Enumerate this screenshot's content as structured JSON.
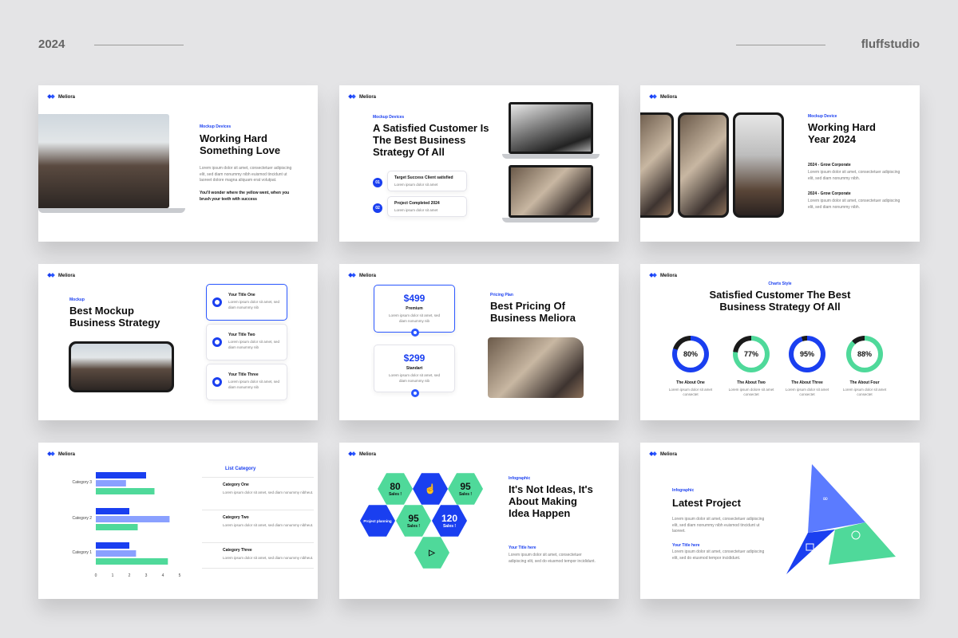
{
  "header": {
    "year": "2024",
    "studio": "fluffstudio"
  },
  "brand": "Meliora",
  "lorem_short": "Lorem ipsum dolor sit amet, consectetur adipiscing elit, sed diam nonummy nibh euismod tincidunt ut laoreet dolore magna aliquam erat.",
  "slides": {
    "s1": {
      "tag": "Mockup Devices",
      "title": "Working Hard Something Love",
      "body": "Lorem ipsum dolor sit amet, consectetuer adipiscing elit, sed diam nonummy nibh euismod tincidunt ut laoreet dolore magna aliquam erat volutpat.",
      "quote": "You'll wonder where the yellow went, when you brush your teeth with success"
    },
    "s2": {
      "tag": "Mockup Devices",
      "title": "A Satisfied Customer Is The Best Business Strategy Of All",
      "items": [
        {
          "num": "01",
          "title": "Target Success Client satisfied",
          "body": "Lorem ipsum dolor sit amet"
        },
        {
          "num": "02",
          "title": "Project Completed 2024",
          "body": "Lorem ipsum dolor sit amet"
        }
      ]
    },
    "s3": {
      "tag": "Mockup Device",
      "title": "Working Hard Year 2024",
      "items": [
        {
          "label": "2024 - Grow Corporate",
          "body": "Lorem ipsum dolor sit amet, consectetuer adipiscing elit, sed diam nonummy nibh."
        },
        {
          "label": "2024 - Grow Corporate",
          "body": "Lorem ipsum dolor sit amet, consectetuer adipiscing elit, sed diam nonummy nibh."
        }
      ]
    },
    "s4": {
      "tag": "Mockup",
      "title": "Best Mockup Business Strategy",
      "cards": [
        {
          "title": "Your Title One",
          "body": "Lorem ipsum dolor sit amet, sed diam nonummy nib"
        },
        {
          "title": "Your Title Two",
          "body": "Lorem ipsum dolor sit amet, sed diam nonummy nib"
        },
        {
          "title": "Your Title Three",
          "body": "Lorem ipsum dolor sit amet, sed diam nonummy nib"
        }
      ]
    },
    "s5": {
      "tag": "Pricing Plan",
      "title": "Best Pricing Of Business Meliora",
      "plans": [
        {
          "price": "$499",
          "name": "Premium",
          "body": "Lorem ipsum dolor sit amet, sed diam nonummy nib"
        },
        {
          "price": "$299",
          "name": "Standart",
          "body": "Lorem ipsum dolor sit amet, sed diam nonummy nib"
        }
      ]
    },
    "s6": {
      "tag": "Charts Style",
      "title": "Satisfied Customer The Best Business Strategy Of All",
      "rings": [
        {
          "pct": "80%",
          "value": 80,
          "label": "The About One",
          "body": "Lorem ipsum dolor sit amet consectet",
          "color": "#1a3ff0"
        },
        {
          "pct": "77%",
          "value": 77,
          "label": "The About Two",
          "body": "Lorem ipsum dolore sit amet consectet",
          "color": "#4fd99a"
        },
        {
          "pct": "95%",
          "value": 95,
          "label": "The About Three",
          "body": "Lorem ipsum dolor sit amet consectet",
          "color": "#1a3ff0"
        },
        {
          "pct": "88%",
          "value": 88,
          "label": "The About Four",
          "body": "Lorem ipsum dolor sit amet consectet",
          "color": "#4fd99a"
        }
      ]
    },
    "s7": {
      "list_title": "List Category",
      "categories": [
        {
          "title": "Category One",
          "body": "Lorem ipsum dolor sit amet, sed diam nonummy nibheut."
        },
        {
          "title": "Category Two",
          "body": "Lorem ipsum dolor sit amet, sed diam nonummy nibheut."
        },
        {
          "title": "Category Three",
          "body": "Lorem ipsum dolor sit amet, sed diam nonummy nibheut."
        }
      ]
    },
    "s8": {
      "tag": "Infographic",
      "title": "It's Not Ideas, It's About Making Idea Happen",
      "subtitle": "Your Title here",
      "body": "Lorem ipsum dolor sit amet, consectetuer adipiscing elit, sed do eiusmod tempor incididunt.",
      "hexes": [
        {
          "n": "80",
          "s": "Sales !"
        },
        {
          "n": "95",
          "s": "Sales !"
        },
        {
          "n": "95",
          "s": "Sales !"
        },
        {
          "n": "120",
          "s": "Sales !"
        },
        {
          "n": "",
          "s": "Project planning"
        }
      ]
    },
    "s9": {
      "tag": "Infographic",
      "title": "Latest Project",
      "body": "Lorem ipsum dolor sit amet, consectetuer adipiscing elit, sed diam nonummy nibh euismod tincidunt ut laoreet.",
      "subtitle": "Your Title here",
      "body2": "Lorem ipsum dolor sit amet, consectetuer adipiscing elit, sed do eiusmod tempor incididunt."
    }
  },
  "chart_data": {
    "type": "bar",
    "orientation": "horizontal",
    "categories": [
      "Category 1",
      "Category 2",
      "Category 3"
    ],
    "series": [
      {
        "name": "",
        "values": [
          2,
          2,
          3
        ],
        "color": "#1a3ff0"
      },
      {
        "name": "",
        "values": [
          2.4,
          4.4,
          1.8
        ],
        "color": "#8aa0ff"
      },
      {
        "name": "",
        "values": [
          4.3,
          2.5,
          3.5
        ],
        "color": "#4fd99a"
      }
    ],
    "xticks": [
      "0",
      "1",
      "2",
      "3",
      "4",
      "5"
    ],
    "xlim": [
      0,
      5
    ]
  }
}
